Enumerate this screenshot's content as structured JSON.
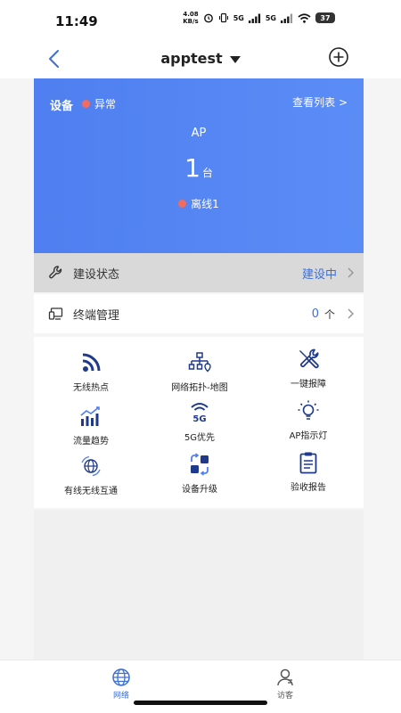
{
  "status_bar": {
    "time": "11:49",
    "net_speed_value": "4.08",
    "net_speed_unit": "KB/s",
    "signal1": "5G",
    "signal2": "5G",
    "battery": "37"
  },
  "header": {
    "title": "apptest",
    "back_icon": "chevron-left-icon",
    "add_icon": "plus-circle-icon"
  },
  "summary": {
    "label": "设备",
    "status": "异常",
    "view_list": "查看列表 >",
    "device_type": "AP",
    "count": "1",
    "count_unit": "台",
    "offline": "离线1",
    "accent": "#4f7ff0",
    "alert_color": "#f26b5e"
  },
  "rows": {
    "build": {
      "label": "建设状态",
      "value": "建设中",
      "icon": "wrench-icon"
    },
    "terminal": {
      "label": "终端管理",
      "value": "0",
      "unit": "个",
      "icon": "terminal-icon"
    }
  },
  "grid": [
    {
      "label": "无线热点",
      "icon": "wifi-hotspot-icon"
    },
    {
      "label": "网络拓扑-地图",
      "icon": "topology-icon"
    },
    {
      "label": "一键报障",
      "icon": "tools-icon"
    },
    {
      "label": "流量趋势",
      "icon": "traffic-trend-icon"
    },
    {
      "label": "5G优先",
      "icon": "5g-icon"
    },
    {
      "label": "AP指示灯",
      "icon": "bulb-icon"
    },
    {
      "label": "有线无线互通",
      "icon": "globe-sync-icon"
    },
    {
      "label": "设备升级",
      "icon": "upgrade-icon"
    },
    {
      "label": "验收报告",
      "icon": "clipboard-icon"
    }
  ],
  "tabs": [
    {
      "label": "网络",
      "icon": "globe-icon",
      "active": true
    },
    {
      "label": "访客",
      "icon": "visitor-icon",
      "active": false
    }
  ]
}
